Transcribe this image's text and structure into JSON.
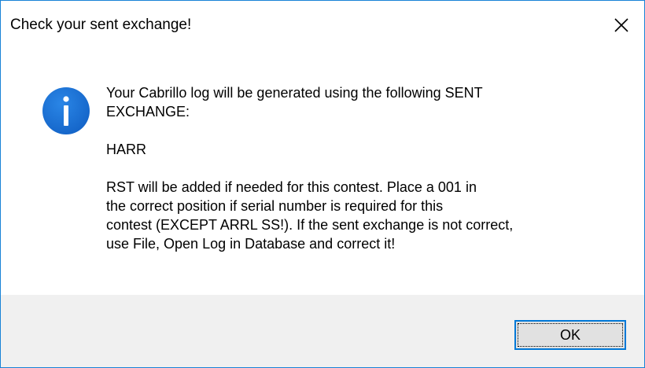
{
  "dialog": {
    "title": "Check your sent exchange!",
    "close_icon": "close-icon",
    "message_icon": "info-icon",
    "colors": {
      "border": "#1883d7",
      "info_icon": "#1c6fd1",
      "footer": "#f0f0f0",
      "button_border": "#0078d7",
      "button_face": "#e1e1e1"
    },
    "message": {
      "line1": "Your Cabrillo log will be generated using the following SENT\nEXCHANGE:",
      "exchange": "HARR",
      "note": "RST will be added if needed for this contest.  Place a 001 in\nthe correct position if serial number is required for this\ncontest (EXCEPT ARRL SS!).  If the sent exchange is not correct,\nuse File, Open Log in Database and correct it!"
    },
    "buttons": {
      "ok_label": "OK"
    }
  }
}
